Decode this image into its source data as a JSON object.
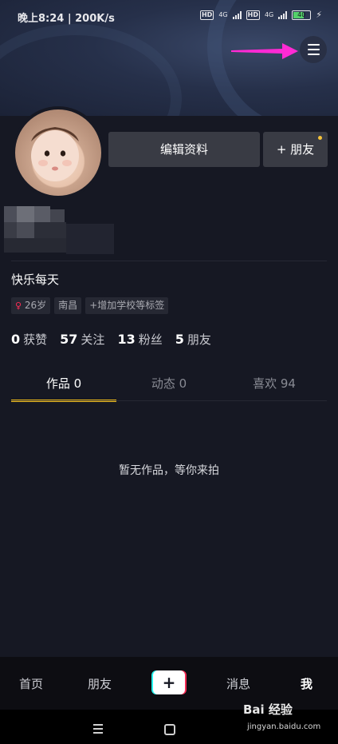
{
  "status_bar": {
    "time": "晚上8:24 | 200K/s",
    "network_1": "4G",
    "network_2": "4G",
    "battery": "40"
  },
  "profile": {
    "edit_label": "编辑资料",
    "add_friend_label": "+ 朋友",
    "bio": "快乐每天",
    "tags": [
      "26岁",
      "南昌",
      "+增加学校等标签"
    ],
    "stats": [
      {
        "value": "0",
        "label": "获赞"
      },
      {
        "value": "57",
        "label": "关注"
      },
      {
        "value": "13",
        "label": "粉丝"
      },
      {
        "value": "5",
        "label": "朋友"
      }
    ]
  },
  "tabs": [
    {
      "label": "作品 0",
      "active": true
    },
    {
      "label": "动态 0",
      "active": false
    },
    {
      "label": "喜欢 94",
      "active": false
    }
  ],
  "empty_text": "暂无作品，等你来拍",
  "bottom_nav": {
    "home": "首页",
    "friends": "朋友",
    "create": "+",
    "messages": "消息",
    "me": "我"
  },
  "watermark": {
    "brand": "Bai 经验",
    "url": "jingyan.baidu.com"
  },
  "colors": {
    "accent_tab": "#f8c21a",
    "arrow": "#ff2ad4",
    "background": "#161823"
  }
}
